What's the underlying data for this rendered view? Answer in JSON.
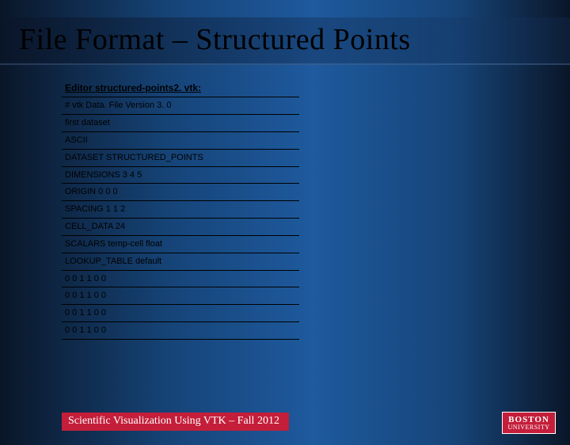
{
  "title": "File Format – Structured Points",
  "table": {
    "header": "Editor structured-points2. vtk:",
    "lines": [
      "# vtk Data. File Version 3. 0",
      "first dataset",
      "ASCII",
      "DATASET STRUCTURED_POINTS",
      "DIMENSIONS 3 4 5",
      "ORIGIN 0 0 0",
      "SPACING 1 1 2",
      "CELL_DATA 24",
      "SCALARS temp-cell float",
      "LOOKUP_TABLE default",
      "0 0 1 1 0 0",
      "0 0 1 1 0 0",
      "0 0 1 1 0 0",
      "0 0 1 1 0 0"
    ]
  },
  "footer": "Scientific Visualization Using VTK – Fall 2012",
  "logo": {
    "line1": "BOSTON",
    "line2": "UNIVERSITY"
  }
}
